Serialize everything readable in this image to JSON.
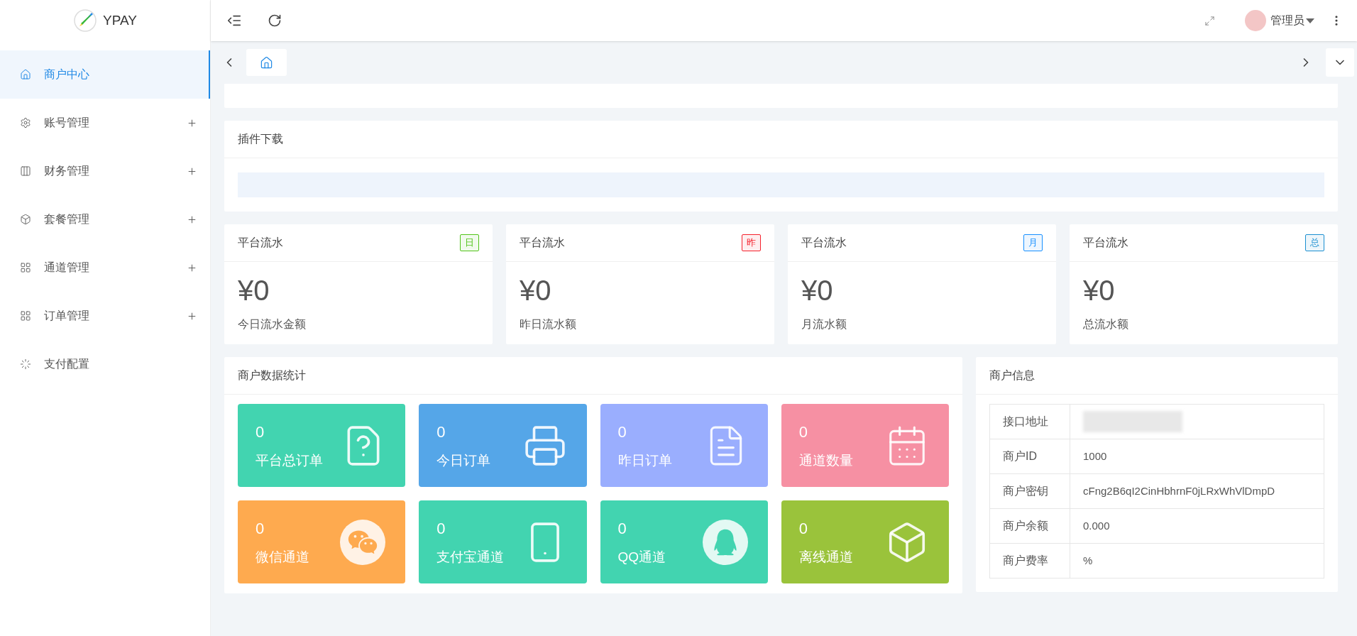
{
  "brand": {
    "name": "YPAY"
  },
  "sidebar": {
    "items": [
      {
        "label": "商户中心",
        "kind": "home",
        "selected": true,
        "expandable": false
      },
      {
        "label": "账号管理",
        "kind": "gear",
        "selected": false,
        "expandable": true
      },
      {
        "label": "财务管理",
        "kind": "ledger",
        "selected": false,
        "expandable": true
      },
      {
        "label": "套餐管理",
        "kind": "cube",
        "selected": false,
        "expandable": true
      },
      {
        "label": "通道管理",
        "kind": "grid",
        "selected": false,
        "expandable": true
      },
      {
        "label": "订单管理",
        "kind": "grid",
        "selected": false,
        "expandable": true
      },
      {
        "label": "支付配置",
        "kind": "spinner",
        "selected": false,
        "expandable": false
      }
    ]
  },
  "header": {
    "user": "管理员"
  },
  "plugin_card": {
    "title": "插件下载"
  },
  "stat_cards": [
    {
      "title": "平台流水",
      "badge": "日",
      "color": "#52c41a",
      "value": "¥0",
      "caption": "今日流水金额"
    },
    {
      "title": "平台流水",
      "badge": "昨",
      "color": "#f5222d",
      "value": "¥0",
      "caption": "昨日流水额"
    },
    {
      "title": "平台流水",
      "badge": "月",
      "color": "#1890ff",
      "value": "¥0",
      "caption": "月流水额"
    },
    {
      "title": "平台流水",
      "badge": "总",
      "color": "#1b8fd1",
      "value": "¥0",
      "caption": "总流水额"
    }
  ],
  "merchant_stats": {
    "title": "商户数据统计",
    "tiles": [
      {
        "value": "0",
        "label": "平台总订单",
        "kind": "note",
        "color": "#42d4b0"
      },
      {
        "value": "0",
        "label": "今日订单",
        "kind": "printer",
        "color": "#55a6e8"
      },
      {
        "value": "0",
        "label": "昨日订单",
        "kind": "list",
        "color": "#9aaefe"
      },
      {
        "value": "0",
        "label": "通道数量",
        "kind": "calendar",
        "color": "#f690a3"
      },
      {
        "value": "0",
        "label": "微信通道",
        "kind": "chat",
        "color": "#feaa4f"
      },
      {
        "value": "0",
        "label": "支付宝通道",
        "kind": "phone",
        "color": "#42d4b0"
      },
      {
        "value": "0",
        "label": "QQ通道",
        "kind": "penguin",
        "color": "#42d4b0"
      },
      {
        "value": "0",
        "label": "离线通道",
        "kind": "cube",
        "color": "#9ac33b"
      }
    ]
  },
  "merchant_info": {
    "title": "商户信息",
    "rows": [
      {
        "label": "接口地址",
        "redacted": true
      },
      {
        "label": "商户ID",
        "value": "1000"
      },
      {
        "label": "商户密钥",
        "value": "cFng2B6qI2CinHbhrnF0jLRxWhVlDmpD"
      },
      {
        "label": "商户余额",
        "value": "0.000"
      },
      {
        "label": "商户费率",
        "value": "%"
      }
    ]
  }
}
